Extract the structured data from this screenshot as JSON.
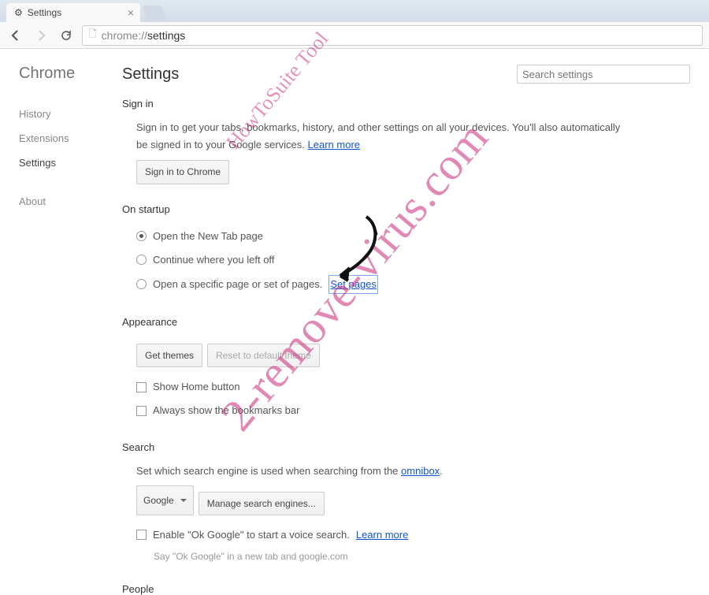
{
  "tab": {
    "title": "Settings"
  },
  "omnibox": {
    "prefix": "chrome://",
    "path": "settings"
  },
  "sidebar": {
    "title": "Chrome",
    "items": [
      "History",
      "Extensions",
      "Settings"
    ],
    "about": "About"
  },
  "main": {
    "title": "Settings",
    "search_placeholder": "Search settings"
  },
  "signin": {
    "title": "Sign in",
    "desc1": "Sign in to get your tabs, bookmarks, history, and other settings on all your devices. You'll also automatically",
    "desc2": "be signed in to your Google services.",
    "learn_more": "Learn more",
    "button": "Sign in to Chrome"
  },
  "startup": {
    "title": "On startup",
    "opt1": "Open the New Tab page",
    "opt2": "Continue where you left off",
    "opt3": "Open a specific page or set of pages.",
    "set_pages": "Set pages"
  },
  "appearance": {
    "title": "Appearance",
    "get_themes": "Get themes",
    "reset_theme": "Reset to default theme",
    "show_home": "Show Home button",
    "show_bookmarks": "Always show the bookmarks bar"
  },
  "search": {
    "title": "Search",
    "desc": "Set which search engine is used when searching from the ",
    "omnibox_link": "omnibox",
    "engine": "Google",
    "manage": "Manage search engines...",
    "ok_google": "Enable \"Ok Google\" to start a voice search.",
    "learn_more": "Learn more",
    "hint": "Say \"Ok Google\" in a new tab and google.com"
  },
  "people": {
    "title": "People"
  },
  "watermark": {
    "main": "2-remove-virus.com",
    "sub": "HowToSuite Tool"
  }
}
